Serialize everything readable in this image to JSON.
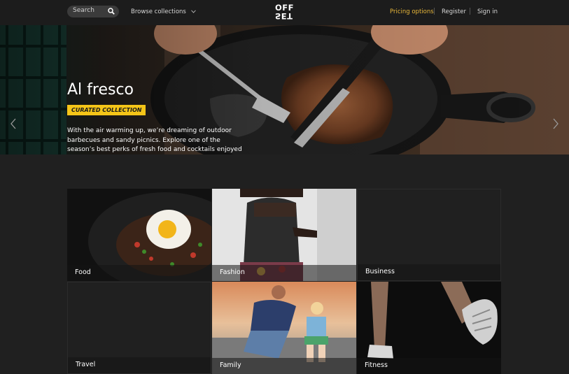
{
  "header": {
    "search_label": "Search",
    "browse_label": "Browse collections",
    "logo_line1": "OFF",
    "logo_line2": "SET",
    "pricing_label": "Pricing options",
    "register_label": "Register",
    "signin_label": "Sign in",
    "accent_color": "#e8b73a"
  },
  "hero": {
    "title": "Al fresco",
    "badge": "CURATED COLLECTION",
    "description": "With the air warming up, we’re dreaming of outdoor barbecues and sandy picnics. Explore one of the season’s best perks of fresh food and cocktails enjoyed al fresco.",
    "badge_color": "#f5c518"
  },
  "categories": [
    {
      "label": "Food"
    },
    {
      "label": "Fashion"
    },
    {
      "label": "Business"
    },
    {
      "label": "Travel"
    },
    {
      "label": "Family"
    },
    {
      "label": "Fitness"
    }
  ]
}
